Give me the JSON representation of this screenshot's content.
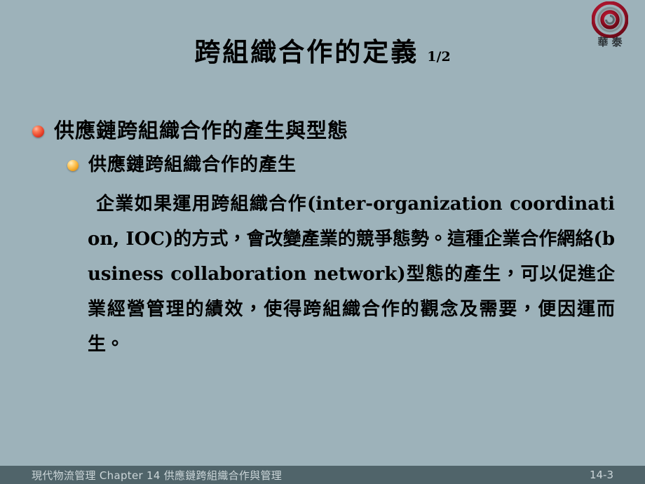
{
  "slide": {
    "background_color": "#9db2ba",
    "title": {
      "main": "跨組織合作的定義",
      "sub": "1/2"
    },
    "logo": {
      "mark_name": "spiral-ring-logo",
      "mark_color": "#9e0f22",
      "text": "華泰"
    },
    "bullets": [
      {
        "level": 1,
        "marker": "red-sphere-bullet",
        "marker_color": "#e8402a",
        "text": "供應鏈跨組織合作的產生與型態"
      },
      {
        "level": 2,
        "marker": "gold-sphere-bullet",
        "marker_color": "#f3a828",
        "text": "供應鏈跨組織合作的產生"
      }
    ],
    "paragraph": "企業如果運用跨組織合作(inter-organization coordination, IOC)的方式，會改變產業的競爭態勢。這種企業合作網絡(business collaboration network)型態的產生，可以促進企業經營管理的績效，使得跨組織合作的觀念及需要，便因運而生。",
    "footer": {
      "background_color": "#50646a",
      "text_color": "#ccd6d9",
      "left": "現代物流管理  Chapter  14   供應鏈跨組織合作與管理",
      "page": "14-3"
    }
  }
}
